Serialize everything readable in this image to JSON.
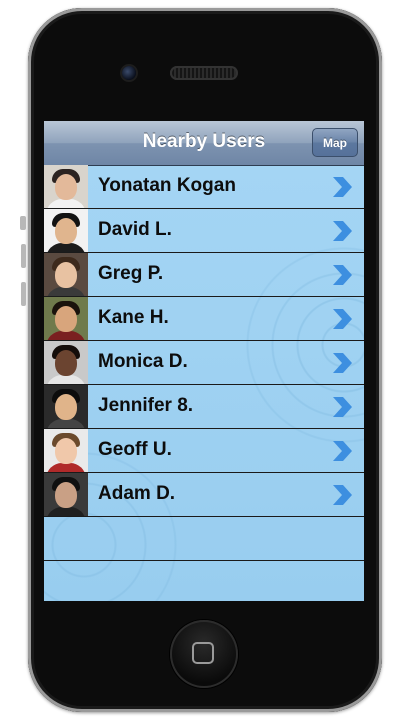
{
  "nav": {
    "title": "Nearby Users",
    "map_button": "Map"
  },
  "users": [
    {
      "name": "Yonatan Kogan",
      "bg": "#d9d4cc",
      "skin": "#e3b99a",
      "hair": "#2b2220",
      "shirt": "#f2f2f2"
    },
    {
      "name": "David L.",
      "bg": "#f2f2f2",
      "skin": "#e0b58e",
      "hair": "#121212",
      "shirt": "#1c1c1c"
    },
    {
      "name": "Greg P.",
      "bg": "#5a4a40",
      "skin": "#e8c2a2",
      "hair": "#3e2a1c",
      "shirt": "#3a3a3a"
    },
    {
      "name": "Kane H.",
      "bg": "#6f7a4c",
      "skin": "#d8a57c",
      "hair": "#1a120c",
      "shirt": "#7a2020"
    },
    {
      "name": "Monica D.",
      "bg": "#c9c9c9",
      "skin": "#6b4430",
      "hair": "#140d0a",
      "shirt": "#e6e6e6"
    },
    {
      "name": "Jennifer 8.",
      "bg": "#2a2a2a",
      "skin": "#e0b48a",
      "hair": "#0c0c0c",
      "shirt": "#444444"
    },
    {
      "name": "Geoff U.",
      "bg": "#eaeaea",
      "skin": "#f0c8aa",
      "hair": "#6b4a2c",
      "shirt": "#b02a2a"
    },
    {
      "name": "Adam D.",
      "bg": "#3a3a3a",
      "skin": "#c9a085",
      "hair": "#101010",
      "shirt": "#202020"
    }
  ],
  "icons": {
    "disclosure": "chevron-right-icon",
    "home": "home-button-icon",
    "camera": "camera-icon",
    "speaker": "speaker-icon"
  },
  "colors": {
    "chevron": "#3d8fe0",
    "list_bg": "#9fd2f2",
    "nav_bg": "#7d93b0"
  }
}
